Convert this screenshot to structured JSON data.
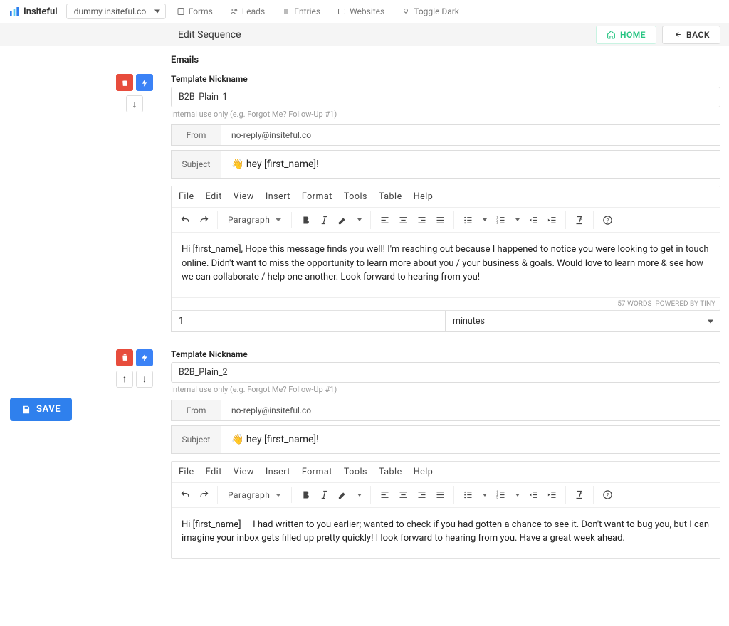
{
  "nav": {
    "brand": "Insiteful",
    "domain": "dummy.insiteful.co",
    "forms": "Forms",
    "leads": "Leads",
    "entries": "Entries",
    "websites": "Websites",
    "toggle_dark": "Toggle Dark"
  },
  "bar": {
    "title": "Edit Sequence",
    "home": "HOME",
    "back": "BACK"
  },
  "section_head": "Emails",
  "emails": [
    {
      "nickname_label": "Template Nickname",
      "nickname": "B2B_Plain_1",
      "hint": "Internal use only (e.g. Forgot Me? Follow-Up #1)",
      "from_label": "From",
      "from_value": "no-reply@insiteful.co",
      "subject_label": "Subject",
      "subject_value": "👋 hey [first_name]!",
      "menu": {
        "file": "File",
        "edit": "Edit",
        "view": "View",
        "insert": "Insert",
        "format": "Format",
        "tools": "Tools",
        "table": "Table",
        "help": "Help"
      },
      "paragraph": "Paragraph",
      "body": "Hi [first_name], Hope this message finds you well! I'm reaching out because I happened to notice you were looking to get in touch online. Didn't want to miss the opportunity to learn more about you / your business & goals. Would love to learn more & see how we can collaborate / help one another. Look forward to hearing from you!",
      "words": "57 WORDS",
      "powered": "POWERED BY TINY",
      "delay_value": "1",
      "delay_unit": "minutes"
    },
    {
      "nickname_label": "Template Nickname",
      "nickname": "B2B_Plain_2",
      "hint": "Internal use only (e.g. Forgot Me? Follow-Up #1)",
      "from_label": "From",
      "from_value": "no-reply@insiteful.co",
      "subject_label": "Subject",
      "subject_value": "👋 hey [first_name]!",
      "menu": {
        "file": "File",
        "edit": "Edit",
        "view": "View",
        "insert": "Insert",
        "format": "Format",
        "tools": "Tools",
        "table": "Table",
        "help": "Help"
      },
      "paragraph": "Paragraph",
      "body": "Hi [first_name] — I had written to you earlier; wanted to check if you had gotten a chance to see it. Don't want to bug you, but I can imagine your inbox gets filled up pretty quickly! I look forward to hearing from you. Have a great week ahead."
    }
  ],
  "save": "SAVE"
}
